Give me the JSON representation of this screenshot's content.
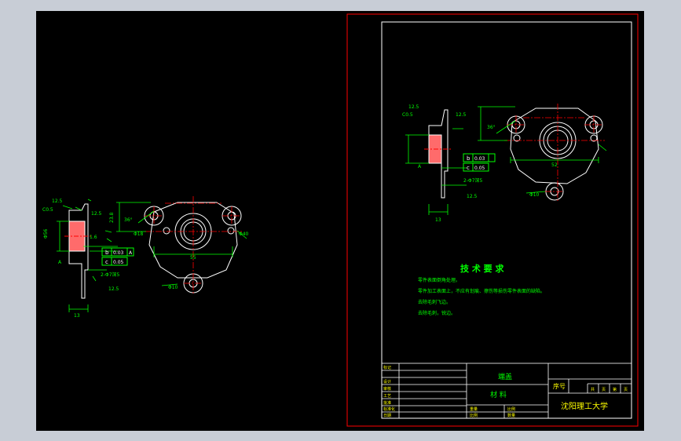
{
  "colors": {
    "background": "#000000",
    "app_frame": "#c8cdd6",
    "outline": "#ffffff",
    "dimension": "#00ff00",
    "centerline": "#ff0000",
    "text_green": "#00ff00",
    "text_yellow": "#ffff00",
    "sheet_border": "#ff0000"
  },
  "left_view": {
    "roughness_1": "12.5",
    "chamfer": "C0.5",
    "roughness_2": "12.5",
    "roughness_3": "1.6",
    "roughness_4": "12.5",
    "angle": "36°",
    "dim_height": "23.8",
    "dim_width": "55",
    "dim_bottom": "13",
    "datum": "A",
    "hole_callout": "2-Φ7深5",
    "hole_dia": "Φ10",
    "tolerance_b_sym": "b",
    "tolerance_b_val": "0.03",
    "tolerance_b_ref": "A",
    "tolerance_c_sym": "c",
    "tolerance_c_val": "0.05",
    "dia_1": "Φ56",
    "dia_2": "Φ40",
    "dia_3": "Φ18"
  },
  "sheet": {
    "view": {
      "roughness_1": "12.5",
      "chamfer": "C0.5",
      "roughness_2": "12.5",
      "angle": "36°",
      "dim_width": "52",
      "dim_bottom": "13",
      "datum": "A",
      "hole_callout": "2-Φ7深5",
      "roughness_3": "12.5",
      "hole_dia": "Φ10",
      "tolerance_b_sym": "b",
      "tolerance_b_val": "0.03",
      "tolerance_c_sym": "c",
      "tolerance_c_val": "0.05"
    },
    "tech": {
      "title": "技 术 要 求",
      "lines": [
        "零件表面倒角处理。",
        "零件加工表面上，不应有划痕、擦伤等损伤零件表面的缺陷。",
        "去除毛刺飞边。",
        "去除毛刺，锐边。"
      ]
    },
    "title_block": {
      "part_name": "端盖",
      "material": "材 料",
      "serial": "序号",
      "school": "沈阳理工大学",
      "small_labels": [
        "标记",
        "设计",
        "审核",
        "工艺",
        "批准",
        "标准化",
        "日期"
      ],
      "grid_labels": [
        "共",
        "页",
        "第",
        "页"
      ],
      "bottom_labels": [
        "重量",
        "比例",
        "比例",
        "数量"
      ]
    }
  }
}
